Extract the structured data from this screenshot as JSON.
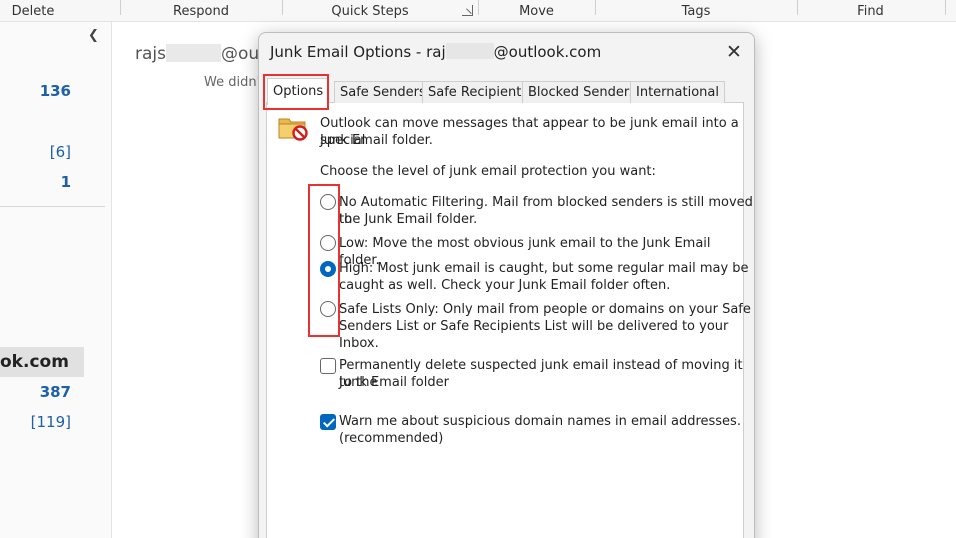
{
  "ribbon": {
    "groups": [
      "Delete",
      "Respond",
      "Quick Steps",
      "Move",
      "Tags",
      "Find"
    ]
  },
  "folder_pane": {
    "counts": [
      "136",
      "[6]",
      "1",
      "387",
      "[119]"
    ],
    "account_label": "ok.com"
  },
  "reading": {
    "from_prefix": "rajs",
    "from_suffix": "@outl",
    "note": "We didn't"
  },
  "dialog": {
    "title_prefix": "Junk Email Options - raj",
    "title_suffix": "@outlook.com",
    "close_label": "✕",
    "tabs": [
      "Options",
      "Safe Senders",
      "Safe Recipients",
      "Blocked Senders",
      "International"
    ],
    "active_tab": "Options",
    "intro_line1": "Outlook can move messages that appear to be junk email into a special",
    "intro_line2": "Junk Email folder.",
    "choose_label": "Choose the level of junk email protection you want:",
    "options": [
      {
        "line1": "No Automatic Filtering. Mail from blocked senders is still moved to",
        "line2": "the Junk Email folder.",
        "checked": false
      },
      {
        "line1": "Low: Move the most obvious junk email to the Junk Email folder.",
        "line2": "",
        "checked": false
      },
      {
        "line1": "High: Most junk email is caught, but some regular mail may be",
        "line2": "caught as well. Check your Junk Email folder often.",
        "checked": true
      },
      {
        "line1": "Safe Lists Only: Only mail from people or domains on your Safe",
        "line2": "Senders List or Safe Recipients List will be delivered to your Inbox.",
        "checked": false
      }
    ],
    "permanent_delete_line1": "Permanently delete suspected junk email instead of moving it to the",
    "permanent_delete_line2": "Junk Email folder",
    "permanent_delete_checked": false,
    "warn_line1": "Warn me about suspicious domain names in email addresses.",
    "warn_line2": "(recommended)",
    "warn_checked": true
  },
  "colors": {
    "accent": "#0067c0",
    "highlight": "#e8322f",
    "count_blue": "#1d5fa8"
  }
}
